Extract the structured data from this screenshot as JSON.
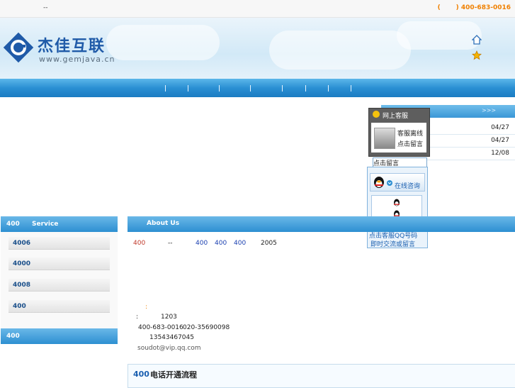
{
  "topbar": {
    "left_text": "--",
    "hotline_prefix": "(",
    "hotline_suffix": ")",
    "hotline": "400-683-0016"
  },
  "logo": {
    "cn": "杰佳互联",
    "url": "www.gemjava.cn"
  },
  "icons": {
    "home": "home-icon",
    "favorite": "star-icon"
  },
  "news": {
    "more": ">>>",
    "dates": [
      "04/27",
      "04/27",
      "12/08"
    ]
  },
  "online_service": {
    "title": "网上客服",
    "offline": "客服离线",
    "leave_msg": "点击留言",
    "msg_button": "点击留言",
    "consult": "在线咨询",
    "footer_line1": "点击客服QQ号码",
    "footer_line2": "即时交流或留言"
  },
  "left": {
    "service_header_num": "400",
    "service_header_title": "Service",
    "tabs": [
      "4006",
      "4000",
      "4008",
      "400"
    ],
    "second_header": "400"
  },
  "about": {
    "header": "About Us",
    "line1_num": "400",
    "line1_dash": "--",
    "line1_a": "400",
    "line1_b": "400",
    "line1_c": "400",
    "line1_year": "2005",
    "colon_orange": ":",
    "addr_colon": ":",
    "addr_num": "1203",
    "phone1": "400-683-0016",
    "phone2": "020-35690098",
    "mobile": "13543467045",
    "email": "soudot@vip.qq.com"
  },
  "flow": {
    "num": "400",
    "title": "电话开通流程"
  }
}
